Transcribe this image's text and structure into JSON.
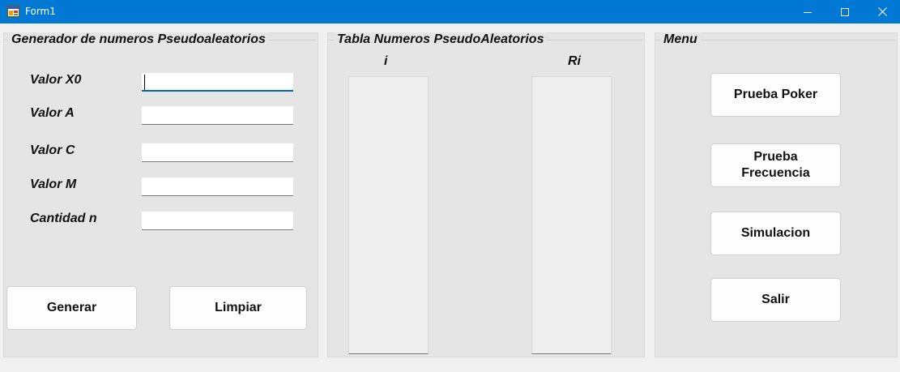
{
  "window": {
    "title": "Form1",
    "icon": "windows-forms-app-icon",
    "controls": [
      "minimize-icon",
      "maximize-icon",
      "close-icon"
    ]
  },
  "generator": {
    "title": "Generador de numeros Pseudoaleatorios",
    "fields": [
      {
        "label": "Valor X0",
        "value": ""
      },
      {
        "label": "Valor A",
        "value": ""
      },
      {
        "label": "Valor C",
        "value": ""
      },
      {
        "label": "Valor M",
        "value": ""
      },
      {
        "label": "Cantidad n",
        "value": ""
      }
    ],
    "generate_label": "Generar",
    "clear_label": "Limpiar"
  },
  "table": {
    "title": "Tabla Numeros PseudoAleatorios",
    "col_i": "i",
    "col_ri": "Ri",
    "i_values": [],
    "ri_values": []
  },
  "menu": {
    "title": "Menu",
    "buttons": [
      "Prueba Poker",
      "Prueba Frecuencia",
      "Simulacion",
      "Salir"
    ]
  },
  "colors": {
    "titlebar": "#0078d4",
    "panel": "#e5e5e5",
    "focus_underline": "#0067c0"
  }
}
